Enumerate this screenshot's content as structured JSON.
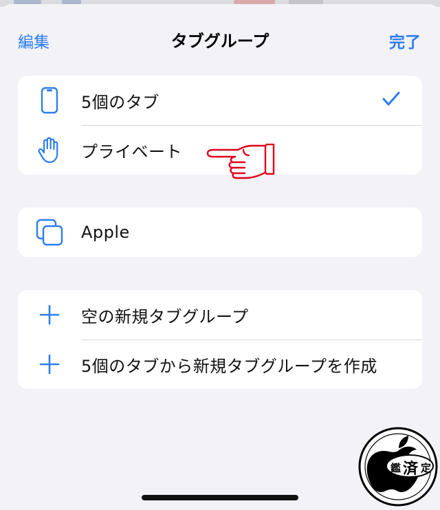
{
  "nav": {
    "edit_label": "編集",
    "title": "タブグループ",
    "done_label": "完了"
  },
  "groups": [
    {
      "rows": [
        {
          "label": "5個のタブ",
          "icon": "iphone-icon",
          "selected": true
        },
        {
          "label": "プライベート",
          "icon": "hand-raised-icon",
          "selected": false
        }
      ]
    },
    {
      "rows": [
        {
          "label": "Apple",
          "icon": "square-on-square-icon",
          "selected": false
        }
      ]
    },
    {
      "rows": [
        {
          "label": "空の新規タブグループ",
          "icon": "plus-icon"
        },
        {
          "label": "5個のタブから新規タブグループを作成",
          "icon": "plus-icon"
        }
      ]
    }
  ],
  "seal": {
    "chars": [
      "鑑",
      "済",
      "定"
    ]
  },
  "colors": {
    "accent": "#2b7cf0",
    "background": "#f2f2f7",
    "annotation": "#e0001a"
  }
}
